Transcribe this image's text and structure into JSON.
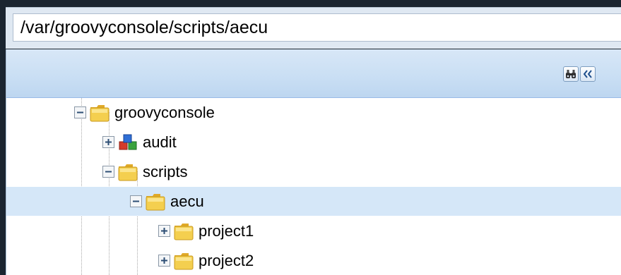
{
  "path_bar": {
    "value": "/var/groovyconsole/scripts/aecu"
  },
  "toolbar": {
    "find_icon": "binoculars-icon",
    "collapse_icon": "double-chevron-left-icon"
  },
  "tree": {
    "nodes": [
      {
        "label": "groovyconsole",
        "icon": "folder-icon",
        "expander": "collapse-icon",
        "selected": false
      },
      {
        "label": "audit",
        "icon": "cubes-icon",
        "expander": "expand-icon",
        "selected": false
      },
      {
        "label": "scripts",
        "icon": "folder-icon",
        "expander": "collapse-icon",
        "selected": false
      },
      {
        "label": "aecu",
        "icon": "folder-icon",
        "expander": "collapse-icon",
        "selected": true
      },
      {
        "label": "project1",
        "icon": "folder-icon",
        "expander": "expand-icon",
        "selected": false
      },
      {
        "label": "project2",
        "icon": "folder-icon",
        "expander": "expand-icon",
        "selected": false
      }
    ]
  },
  "colors": {
    "selection": "#d5e7f8",
    "toolbar": "#cadff4",
    "folder": "#f2c94c"
  }
}
